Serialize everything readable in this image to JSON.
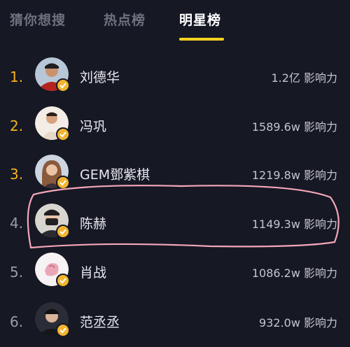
{
  "tabs": [
    {
      "label": "猜你想搜"
    },
    {
      "label": "热点榜"
    },
    {
      "label": "明星榜",
      "active": true
    }
  ],
  "ranking": [
    {
      "rank": "1.",
      "name": "刘德华",
      "score": "1.2亿 影响力",
      "avatar": "avatar-liu-dehua"
    },
    {
      "rank": "2.",
      "name": "冯巩",
      "score": "1589.6w 影响力",
      "avatar": "avatar-feng-gong"
    },
    {
      "rank": "3.",
      "name": "GEM鄧紫棋",
      "score": "1219.8w 影响力",
      "avatar": "avatar-gem"
    },
    {
      "rank": "4.",
      "name": "陈赫",
      "score": "1149.3w 影响力",
      "avatar": "avatar-chen-he"
    },
    {
      "rank": "5.",
      "name": "肖战",
      "score": "1086.2w 影响力",
      "avatar": "avatar-xiao-zhan"
    },
    {
      "rank": "6.",
      "name": "范丞丞",
      "score": "932.0w 影响力",
      "avatar": "avatar-fan-chengcheng"
    }
  ],
  "colors": {
    "background": "#161824",
    "accent": "#ffd21f",
    "rank_top": "#f5b21a",
    "verified_badge": "#f2b531",
    "annotation": "#f4a7b9"
  }
}
